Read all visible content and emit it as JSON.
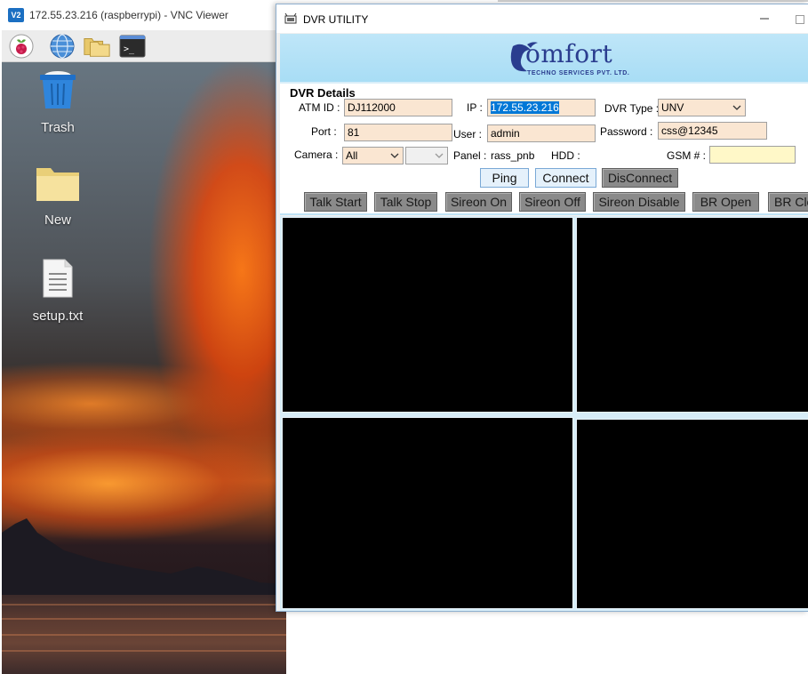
{
  "vnc": {
    "title": "172.55.23.216 (raspberrypi) - VNC Viewer",
    "icon_text": "V2"
  },
  "desktop": {
    "panel": {
      "items": [
        "raspberry-menu",
        "web-browser",
        "file-manager",
        "terminal"
      ]
    },
    "icons": [
      {
        "label": "Trash",
        "icon": "trash-icon"
      },
      {
        "label": "New",
        "icon": "folder-icon"
      },
      {
        "label": "setup.txt",
        "icon": "text-file-icon"
      }
    ]
  },
  "dvr_window": {
    "title": "DVR UTILITY",
    "brand": {
      "name": "omfort",
      "subtitle": "TECHNO SERVICES PVT. LTD."
    },
    "section_title": "DVR Details",
    "fields": {
      "atm_id": {
        "label": "ATM ID :",
        "value": "DJ112000"
      },
      "ip": {
        "label": "IP :",
        "value": "172.55.23.216"
      },
      "dvr_type": {
        "label": "DVR Type :",
        "value": "UNV"
      },
      "port": {
        "label": "Port :",
        "value": "81"
      },
      "user": {
        "label": "User :",
        "value": "admin"
      },
      "password": {
        "label": "Password :",
        "value": "css@12345"
      },
      "camera": {
        "label": "Camera :",
        "value": "All",
        "secondary_value": ""
      },
      "panel": {
        "label": "Panel :",
        "value": "rass_pnb"
      },
      "hdd": {
        "label": "HDD :",
        "value": ""
      },
      "gsm": {
        "label": "GSM # :",
        "value": ""
      }
    },
    "buttons_row1": [
      "Ping",
      "Connect",
      "DisConnect"
    ],
    "buttons_row2": [
      "Talk Start",
      "Talk Stop",
      "Sireon On",
      "Sireon Off",
      "Sireon Disable",
      "BR Open",
      "BR Clo"
    ],
    "video_tiles": 4
  },
  "colors": {
    "banner": "#a8ddf5",
    "input_bg": "#fae6d2",
    "gsm_bg": "#fff8c8",
    "brand_blue": "#2a3d8f",
    "video_bg": "#000000"
  }
}
